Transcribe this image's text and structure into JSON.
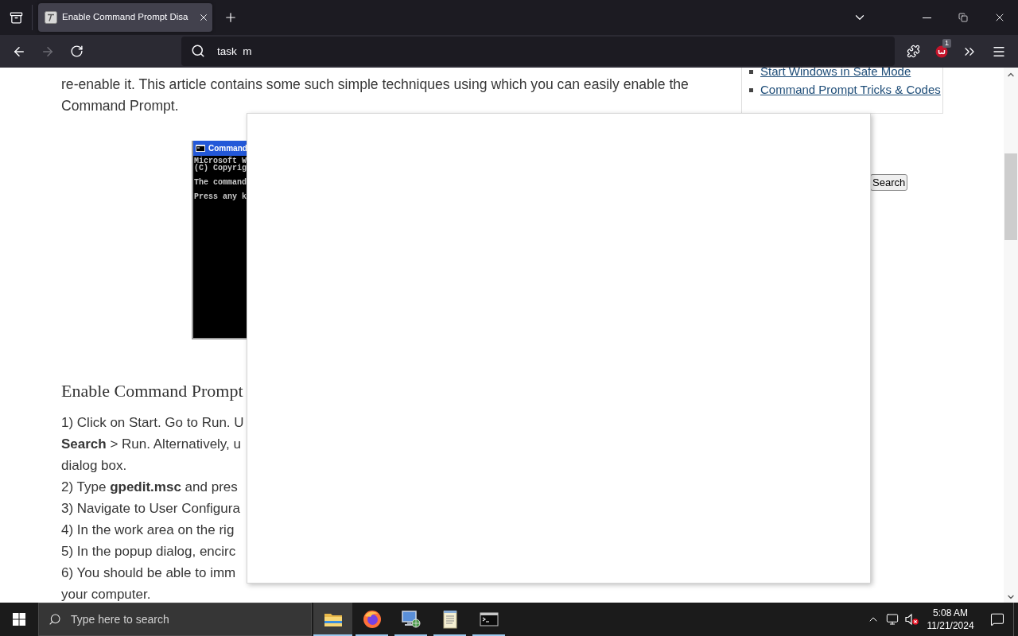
{
  "browser": {
    "tabs": [
      {
        "title": "Enable Command Prompt Disa",
        "selected": true
      }
    ],
    "nav_buttons": [
      {
        "kind": "back",
        "disabled": false
      },
      {
        "kind": "forward",
        "disabled": true
      },
      {
        "kind": "reload",
        "disabled": false
      }
    ],
    "address_bar": {
      "value": "task  m"
    },
    "extension_badge": "1"
  },
  "article": {
    "intro_lines": [
      "re-enable it. This article contains some such simple techniques using which you can easily enable the",
      "Command Prompt."
    ],
    "figure": {
      "title": "Command",
      "line_groups": [
        [
          "Microsoft W",
          "(C) Copyrig"
        ],
        [
          "The command"
        ],
        [
          "Press any k"
        ]
      ]
    },
    "heading": "Enable Command Prompt",
    "steps": [
      {
        "lines": [
          "1) Click on Start. Go to Run. U",
          "**Search** > Run. Alternatively, u",
          "dialog box."
        ]
      },
      {
        "lines": [
          "2) Type **gpedit.msc** and pres"
        ]
      },
      {
        "lines": [
          "3) Navigate to User Configura"
        ]
      },
      {
        "lines": [
          "4) In the work area on the rig"
        ]
      },
      {
        "lines": [
          "5) In the popup dialog, encirc"
        ]
      },
      {
        "lines": [
          "6) You should be able to imm",
          "your computer."
        ]
      }
    ]
  },
  "sidebar": {
    "links": [
      "Start Windows in Safe Mode",
      "Command Prompt Tricks & Codes"
    ],
    "search_button": "Search"
  },
  "taskbar": {
    "search_placeholder": "Type here to search",
    "apps": [
      {
        "kind": "folder",
        "selected": true,
        "running": true
      },
      {
        "kind": "browser",
        "selected": false,
        "running": true
      },
      {
        "kind": "computer",
        "selected": false,
        "running": true
      },
      {
        "kind": "notepad",
        "selected": false,
        "running": true
      },
      {
        "kind": "terminal",
        "selected": false,
        "running": true
      }
    ],
    "time": "5:08 AM",
    "date": "11/21/2024"
  }
}
